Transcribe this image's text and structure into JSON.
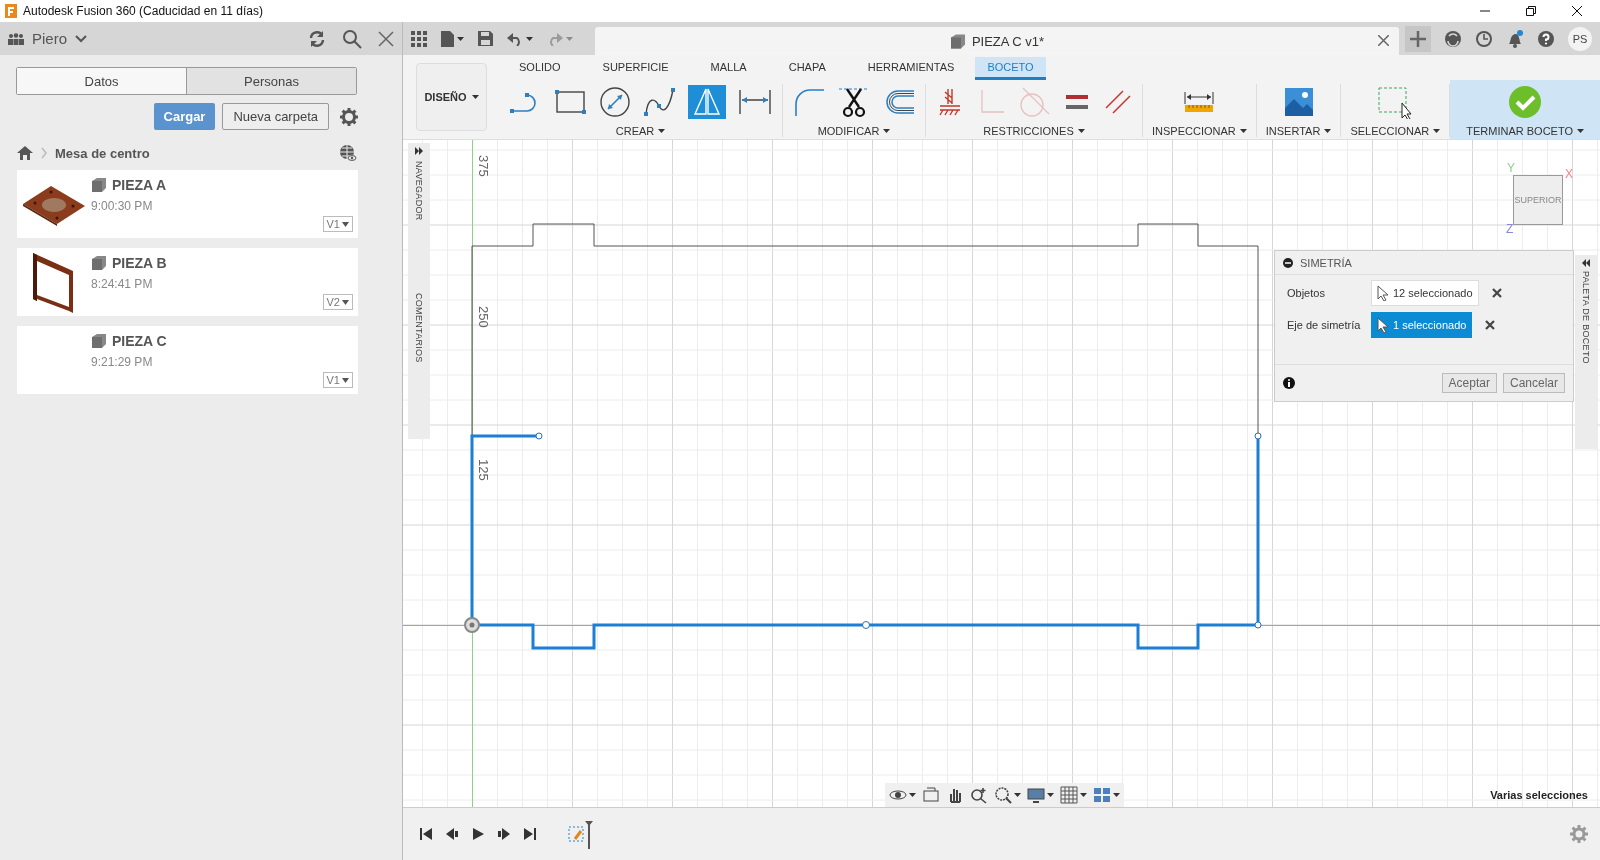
{
  "window": {
    "title": "Autodesk Fusion 360 (Caducidad en 11 días)"
  },
  "data_panel": {
    "user": "Piero",
    "tabs": [
      {
        "label": "Datos",
        "selected": true
      },
      {
        "label": "Personas",
        "selected": false
      }
    ],
    "upload_button": "Cargar",
    "new_folder_button": "Nueva carpeta",
    "breadcrumb": "Mesa de centro",
    "items": [
      {
        "name": "PIEZA A",
        "time": "9:00:30 PM",
        "version": "V1",
        "kind": "plate"
      },
      {
        "name": "PIEZA B",
        "time": "8:24:41 PM",
        "version": "V2",
        "kind": "frame"
      },
      {
        "name": "PIEZA C",
        "time": "9:21:29 PM",
        "version": "V1",
        "kind": "empty"
      }
    ]
  },
  "document_tab": {
    "title": "PIEZA C v1*"
  },
  "avatar": "PS",
  "ribbon": {
    "workspace": "DISEÑO",
    "tabs": [
      {
        "label": "SOLIDO",
        "selected": false
      },
      {
        "label": "SUPERFICIE",
        "selected": false
      },
      {
        "label": "MALLA",
        "selected": false
      },
      {
        "label": "CHAPA",
        "selected": false
      },
      {
        "label": "HERRAMIENTAS",
        "selected": false
      },
      {
        "label": "BOCETO",
        "selected": true
      }
    ],
    "groups": [
      {
        "label": "CREAR",
        "highlighted": false,
        "tools": [
          {
            "kind": "line",
            "selected": false,
            "disabled": false
          },
          {
            "kind": "rectangle",
            "selected": false,
            "disabled": false
          },
          {
            "kind": "circle",
            "selected": false,
            "disabled": false
          },
          {
            "kind": "spline",
            "selected": false,
            "disabled": false
          },
          {
            "kind": "mirror",
            "selected": true,
            "disabled": false
          },
          {
            "kind": "dimension",
            "selected": false,
            "disabled": false
          }
        ]
      },
      {
        "label": "MODIFICAR",
        "highlighted": false,
        "tools": [
          {
            "kind": "fillet",
            "selected": false,
            "disabled": false
          },
          {
            "kind": "trim",
            "selected": false,
            "disabled": false
          },
          {
            "kind": "offset",
            "selected": false,
            "disabled": false
          }
        ]
      },
      {
        "label": "RESTRICCIONES",
        "highlighted": false,
        "tools": [
          {
            "kind": "coincident",
            "selected": false,
            "disabled": false
          },
          {
            "kind": "collinear",
            "selected": false,
            "disabled": true
          },
          {
            "kind": "tangent",
            "selected": false,
            "disabled": true
          },
          {
            "kind": "equal",
            "selected": false,
            "disabled": false
          },
          {
            "kind": "parallel",
            "selected": false,
            "disabled": false
          }
        ]
      },
      {
        "label": "INSPECCIONAR",
        "highlighted": false,
        "tools": [
          {
            "kind": "measure",
            "selected": false,
            "disabled": false
          }
        ]
      },
      {
        "label": "INSERTAR",
        "highlighted": false,
        "tools": [
          {
            "kind": "image",
            "selected": false,
            "disabled": false
          }
        ]
      },
      {
        "label": "SELECCIONAR",
        "highlighted": false,
        "tools": [
          {
            "kind": "select",
            "selected": false,
            "disabled": false
          }
        ]
      },
      {
        "label": "TERMINAR BOCETO",
        "highlighted": true,
        "tools": [
          {
            "kind": "finish",
            "selected": false,
            "disabled": false
          }
        ]
      }
    ]
  },
  "canvas": {
    "navigator": "NAVEGADOR",
    "comments": "COMENTARIOS",
    "sketch_palette": "PALETA DE BOCETO",
    "dimension_labels": [
      "375",
      "250",
      "125"
    ],
    "view_cube": {
      "face": "SUPERIOR",
      "x_axis": "X",
      "y_axis": "Y",
      "z_axis": "Z"
    },
    "dialog": {
      "title": "SIMETRÍA",
      "rows": [
        {
          "label": "Objetos",
          "value": "12 seleccionado",
          "selected": false
        },
        {
          "label": "Eje de simetría",
          "value": "1 seleccionado",
          "selected": true
        }
      ],
      "buttons": [
        "Aceptar",
        "Cancelar"
      ]
    },
    "status": "Varias selecciones"
  }
}
